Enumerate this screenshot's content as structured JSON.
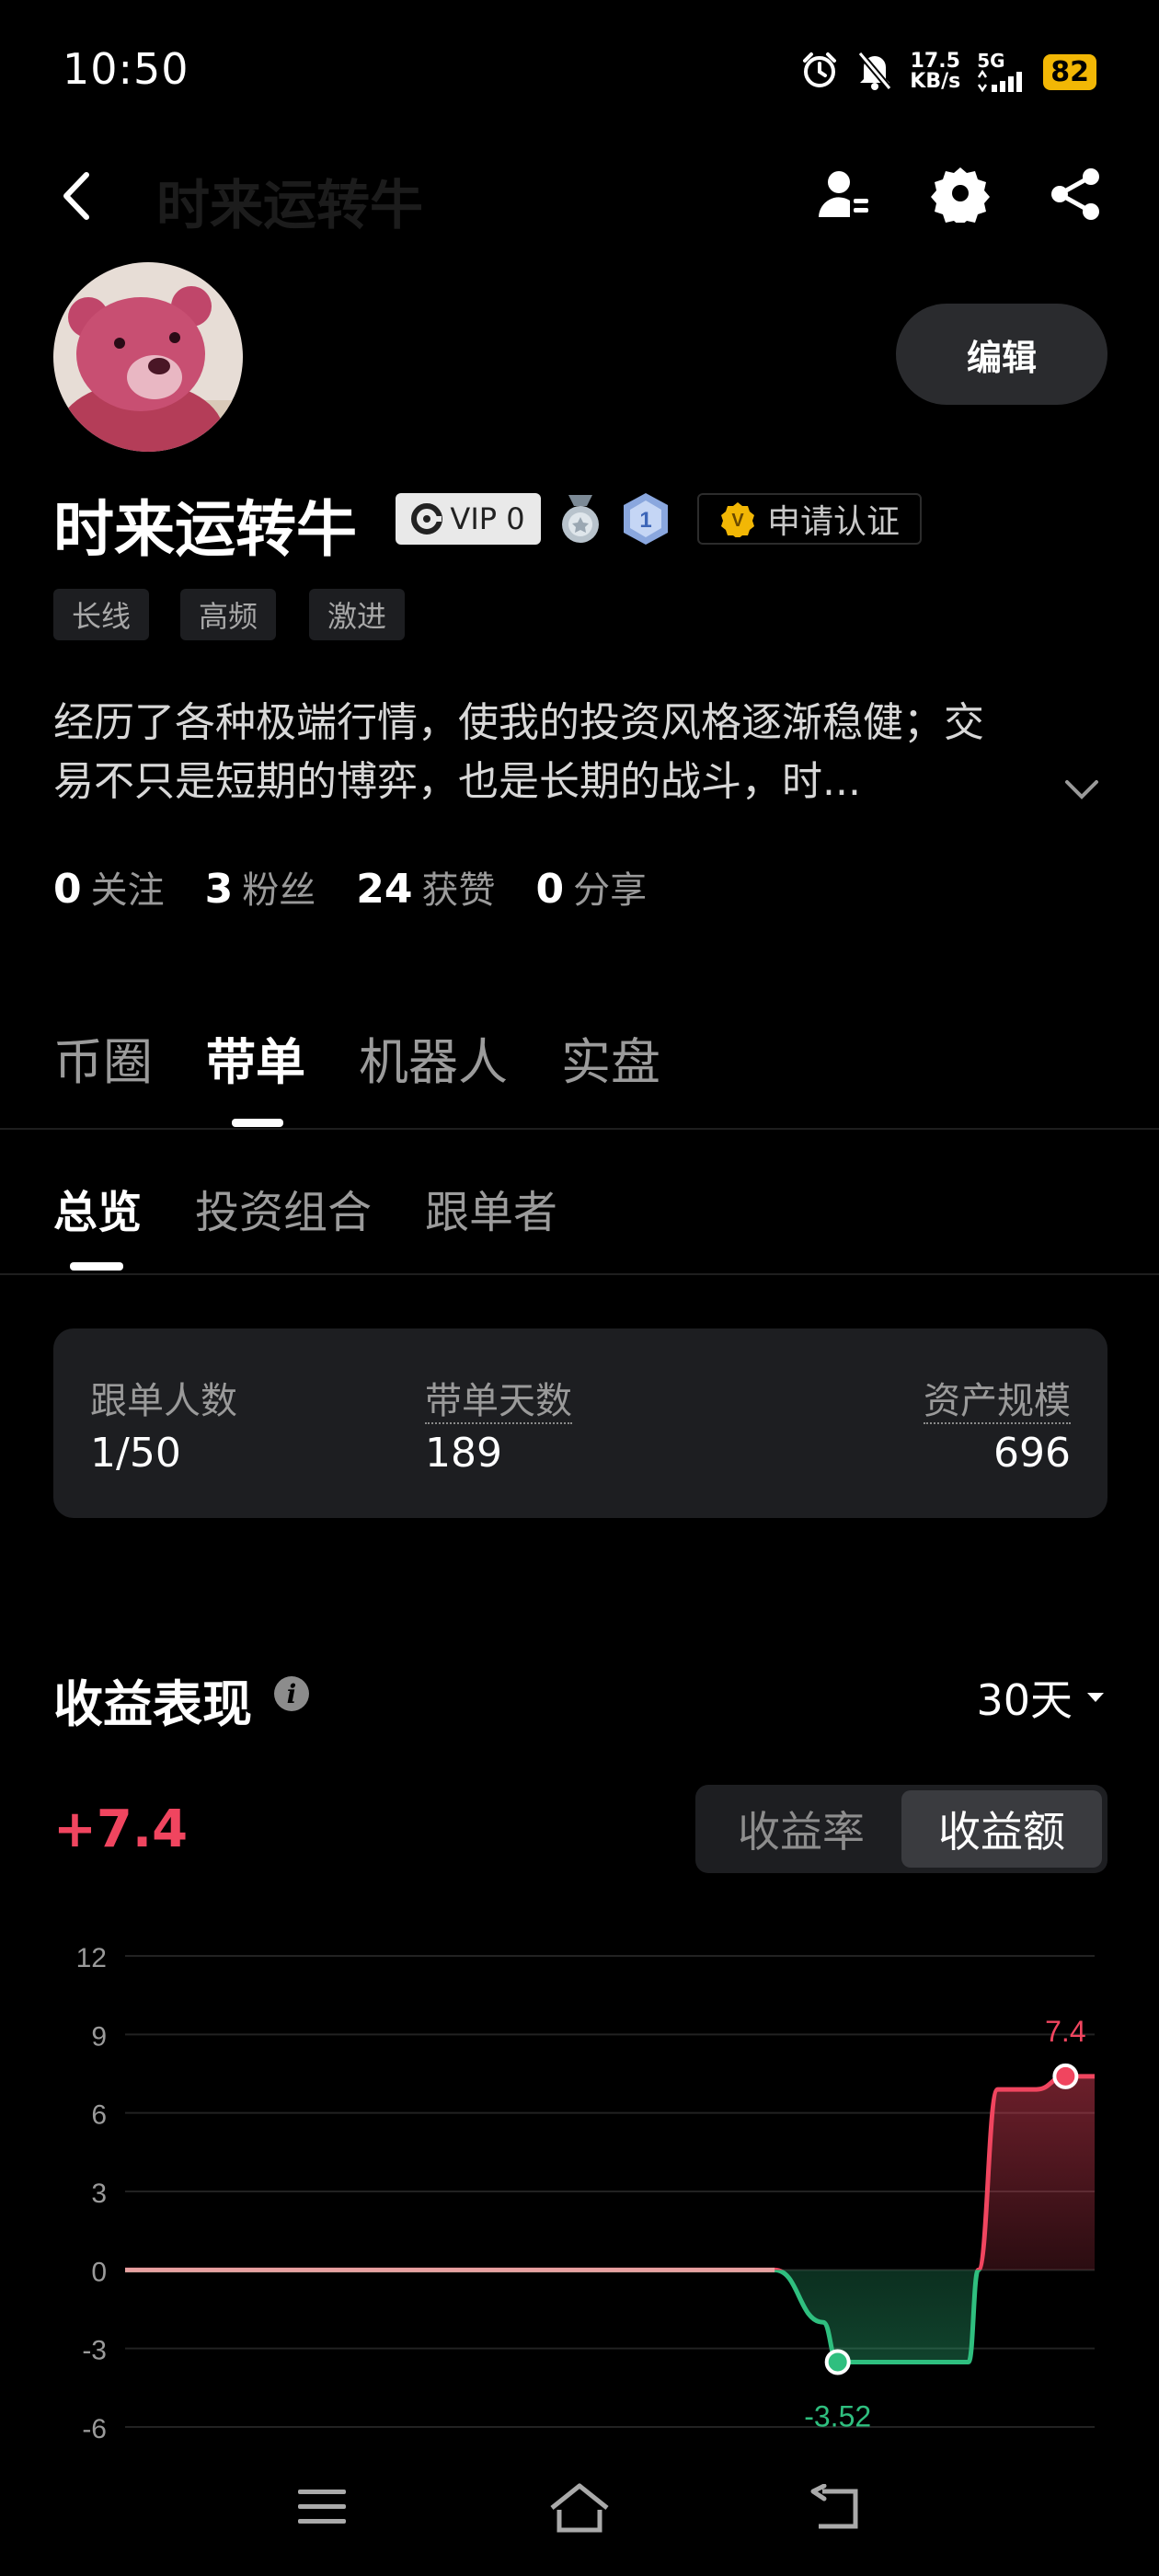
{
  "status_bar": {
    "time": "10:50",
    "net_speed_value": "17.5",
    "net_speed_unit": "KB/s",
    "network": "5G",
    "battery": "82"
  },
  "header": {
    "ghost_title": "时来运转牛"
  },
  "profile": {
    "edit_label": "编辑",
    "username": "时来运转牛",
    "vip_label": "VIP 0",
    "level_badge": "1",
    "cert_label": "申请认证",
    "cert_mark": "V",
    "tags": [
      "长线",
      "高频",
      "激进"
    ],
    "bio_line1": "经历了各种极端行情，使我的投资风格逐渐稳健；交",
    "bio_line2": "易不只是短期的博弈，也是长期的战斗，时...",
    "stats": [
      {
        "value": "0",
        "label": "关注"
      },
      {
        "value": "3",
        "label": "粉丝"
      },
      {
        "value": "24",
        "label": "获赞"
      },
      {
        "value": "0",
        "label": "分享"
      }
    ]
  },
  "main_tabs": [
    "币圈",
    "带单",
    "机器人",
    "实盘"
  ],
  "main_tab_active": "带单",
  "sub_tabs": [
    "总览",
    "投资组合",
    "跟单者"
  ],
  "sub_tab_active": "总览",
  "summary": {
    "followers_label": "跟单人数",
    "followers_value": "1/50",
    "days_label": "带单天数",
    "days_value": "189",
    "aum_label": "资产规模",
    "aum_value": "696"
  },
  "performance": {
    "title": "收益表现",
    "period": "30天",
    "profit": "+7.4",
    "toggle": [
      "收益率",
      "收益额"
    ],
    "toggle_active": "收益额"
  },
  "colors": {
    "positive": "#f0455f",
    "negative": "#2fbf7f",
    "card_bg": "#1d1e21"
  },
  "chart_data": {
    "type": "line",
    "yticks": [
      12,
      9,
      6,
      3,
      0,
      -3,
      -6
    ],
    "ylim": [
      -6,
      12
    ],
    "x": [
      0,
      0.15,
      0.3,
      0.45,
      0.6,
      0.67,
      0.72,
      0.735,
      0.8,
      0.87,
      0.88,
      0.9,
      0.94,
      0.97,
      1.0
    ],
    "values": [
      0,
      0,
      0,
      0,
      0,
      0,
      -2,
      -3.52,
      -3.52,
      -3.52,
      0,
      6.9,
      6.9,
      7.4,
      7.4
    ],
    "min_label": "-3.52",
    "max_label": "7.4"
  }
}
